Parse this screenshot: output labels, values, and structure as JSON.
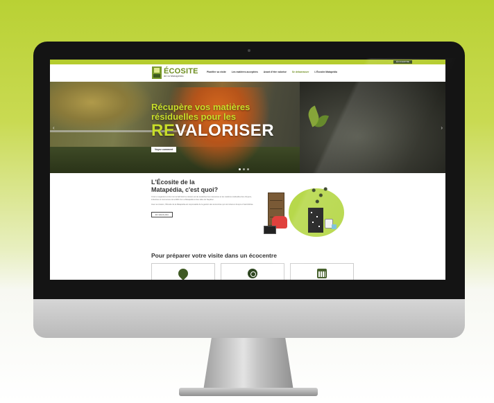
{
  "topbar": {
    "links": "· · ·",
    "button": "ÉCOCENTRE"
  },
  "nav": {
    "logo_title": "ÉCOSITE",
    "logo_subtitle": "de la Matapédia",
    "menu": [
      "Planifier sa visite",
      "Les matières acceptées",
      "Avant d'être valorisé",
      "Se débarrasser",
      "L'Écosite Matapédia"
    ]
  },
  "hero": {
    "line1": "Récupère vos matières",
    "line2": "résiduelles pour les",
    "big_prefix": "RE",
    "big_rest": "VALORISER",
    "button": "Voyez comment",
    "prev": "‹",
    "next": "›",
    "slides": 3
  },
  "about": {
    "title_line1": "L'Écosite de la",
    "title_line2": "Matapédia, c'est quoi?",
    "para1": "C'est un organisme à but non lucratif dont la mission est de revaloriser les ressources et les matières résiduelles des citoyens, industries et commerces de la MRC de La Matapédia et des villes de Sayabec.",
    "para2": "Avec sa mission, l'Écosite de la Matapédia est responsable de la gestion des écocentres qui sont situés à Amqui et Saint-Moïse.",
    "button": "En savoir plus"
  },
  "visit": {
    "title": "Pour préparer votre visite dans un écocentre",
    "cards": [
      "location-pin-icon",
      "recycle-icon",
      "calendar-icon"
    ]
  },
  "colors": {
    "brand_green": "#b5cc2e",
    "hero_text": "#c8de2a",
    "dark_green": "#3f5a24"
  }
}
